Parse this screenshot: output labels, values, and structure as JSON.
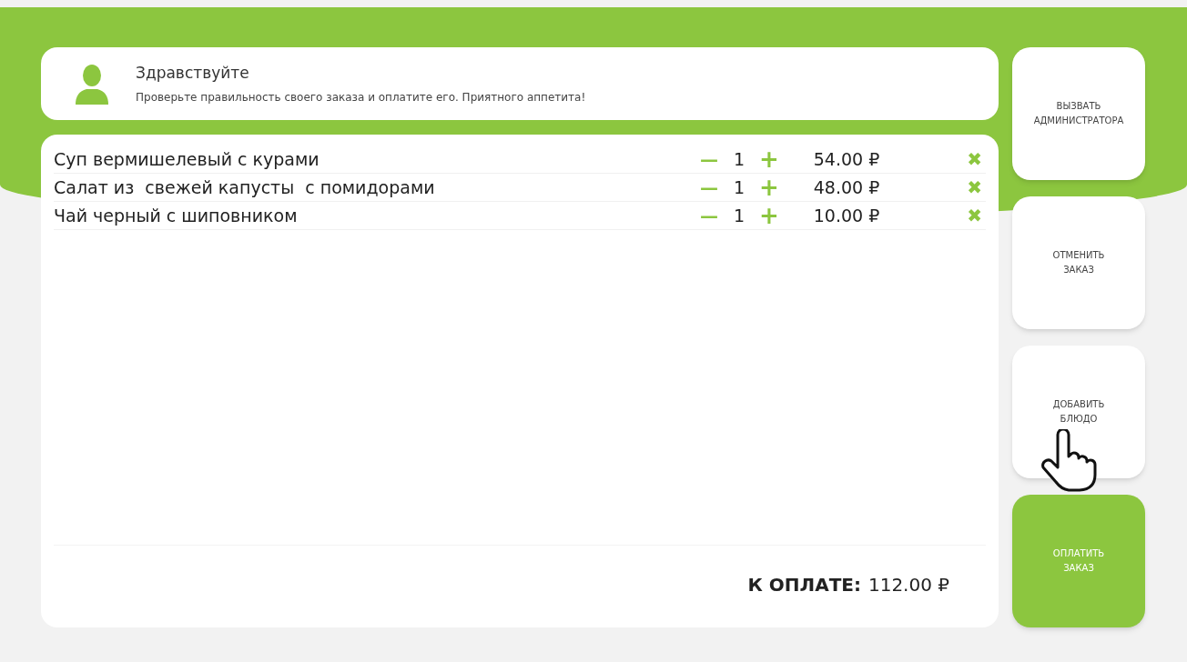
{
  "greeting": {
    "title": "Здравствуйте",
    "message": "Проверьте правильность своего заказа и оплатите его. Приятного аппетита!"
  },
  "order": {
    "items": [
      {
        "name": "Суп вермишелевый с курами",
        "minus": "—",
        "quantity": "1",
        "plus": "+",
        "price": "54.00 ₽",
        "remove": "✖"
      },
      {
        "name": "Салат из  свежей капусты  с помидорами",
        "minus": "—",
        "quantity": "1",
        "plus": "+",
        "price": "48.00 ₽",
        "remove": "✖"
      },
      {
        "name": "Чай черный с шиповником",
        "minus": "—",
        "quantity": "1",
        "plus": "+",
        "price": "10.00 ₽",
        "remove": "✖"
      }
    ],
    "total_label": "К ОПЛАТЕ:",
    "total_value": "112.00 ₽"
  },
  "actions": [
    {
      "kind": "secondary",
      "lines": [
        "ВЫЗВАТЬ",
        "АДМИНИСТРАТОРА"
      ]
    },
    {
      "kind": "secondary",
      "lines": [
        "ОТМЕНИТЬ",
        "ЗАКАЗ"
      ]
    },
    {
      "kind": "secondary",
      "lines": [
        "ДОБАВИТЬ",
        "БЛЮДО"
      ],
      "pointer": true
    },
    {
      "kind": "primary",
      "lines": [
        "ОПЛАТИТЬ",
        "ЗАКАЗ"
      ]
    }
  ]
}
